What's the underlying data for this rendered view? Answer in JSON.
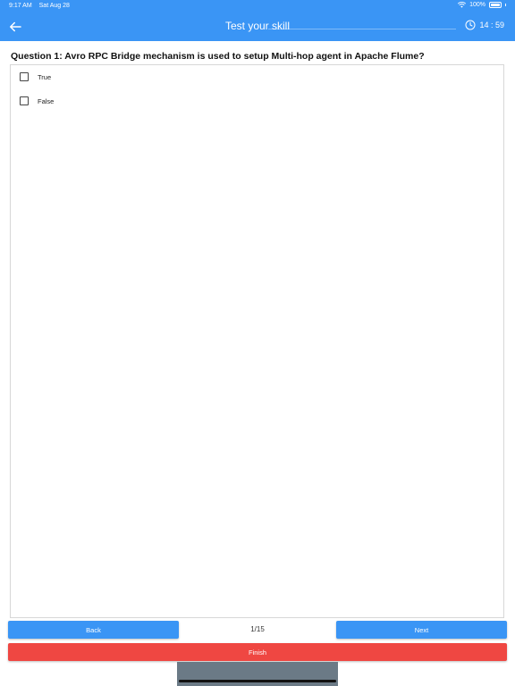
{
  "status_bar": {
    "time": "9:17 AM",
    "date": "Sat Aug 28",
    "battery": "100%"
  },
  "nav": {
    "title": "Test your skill",
    "timer": "14 : 59"
  },
  "question": {
    "text": "Question 1: Avro RPC Bridge mechanism is used to setup Multi-hop agent in Apache Flume?"
  },
  "options": [
    {
      "label": "True"
    },
    {
      "label": "False"
    }
  ],
  "footer": {
    "back_label": "Back",
    "page_counter": "1/15",
    "next_label": "Next",
    "finish_label": "Finish"
  },
  "colors": {
    "primary": "#3a95f5",
    "finish": "#ef4742"
  }
}
